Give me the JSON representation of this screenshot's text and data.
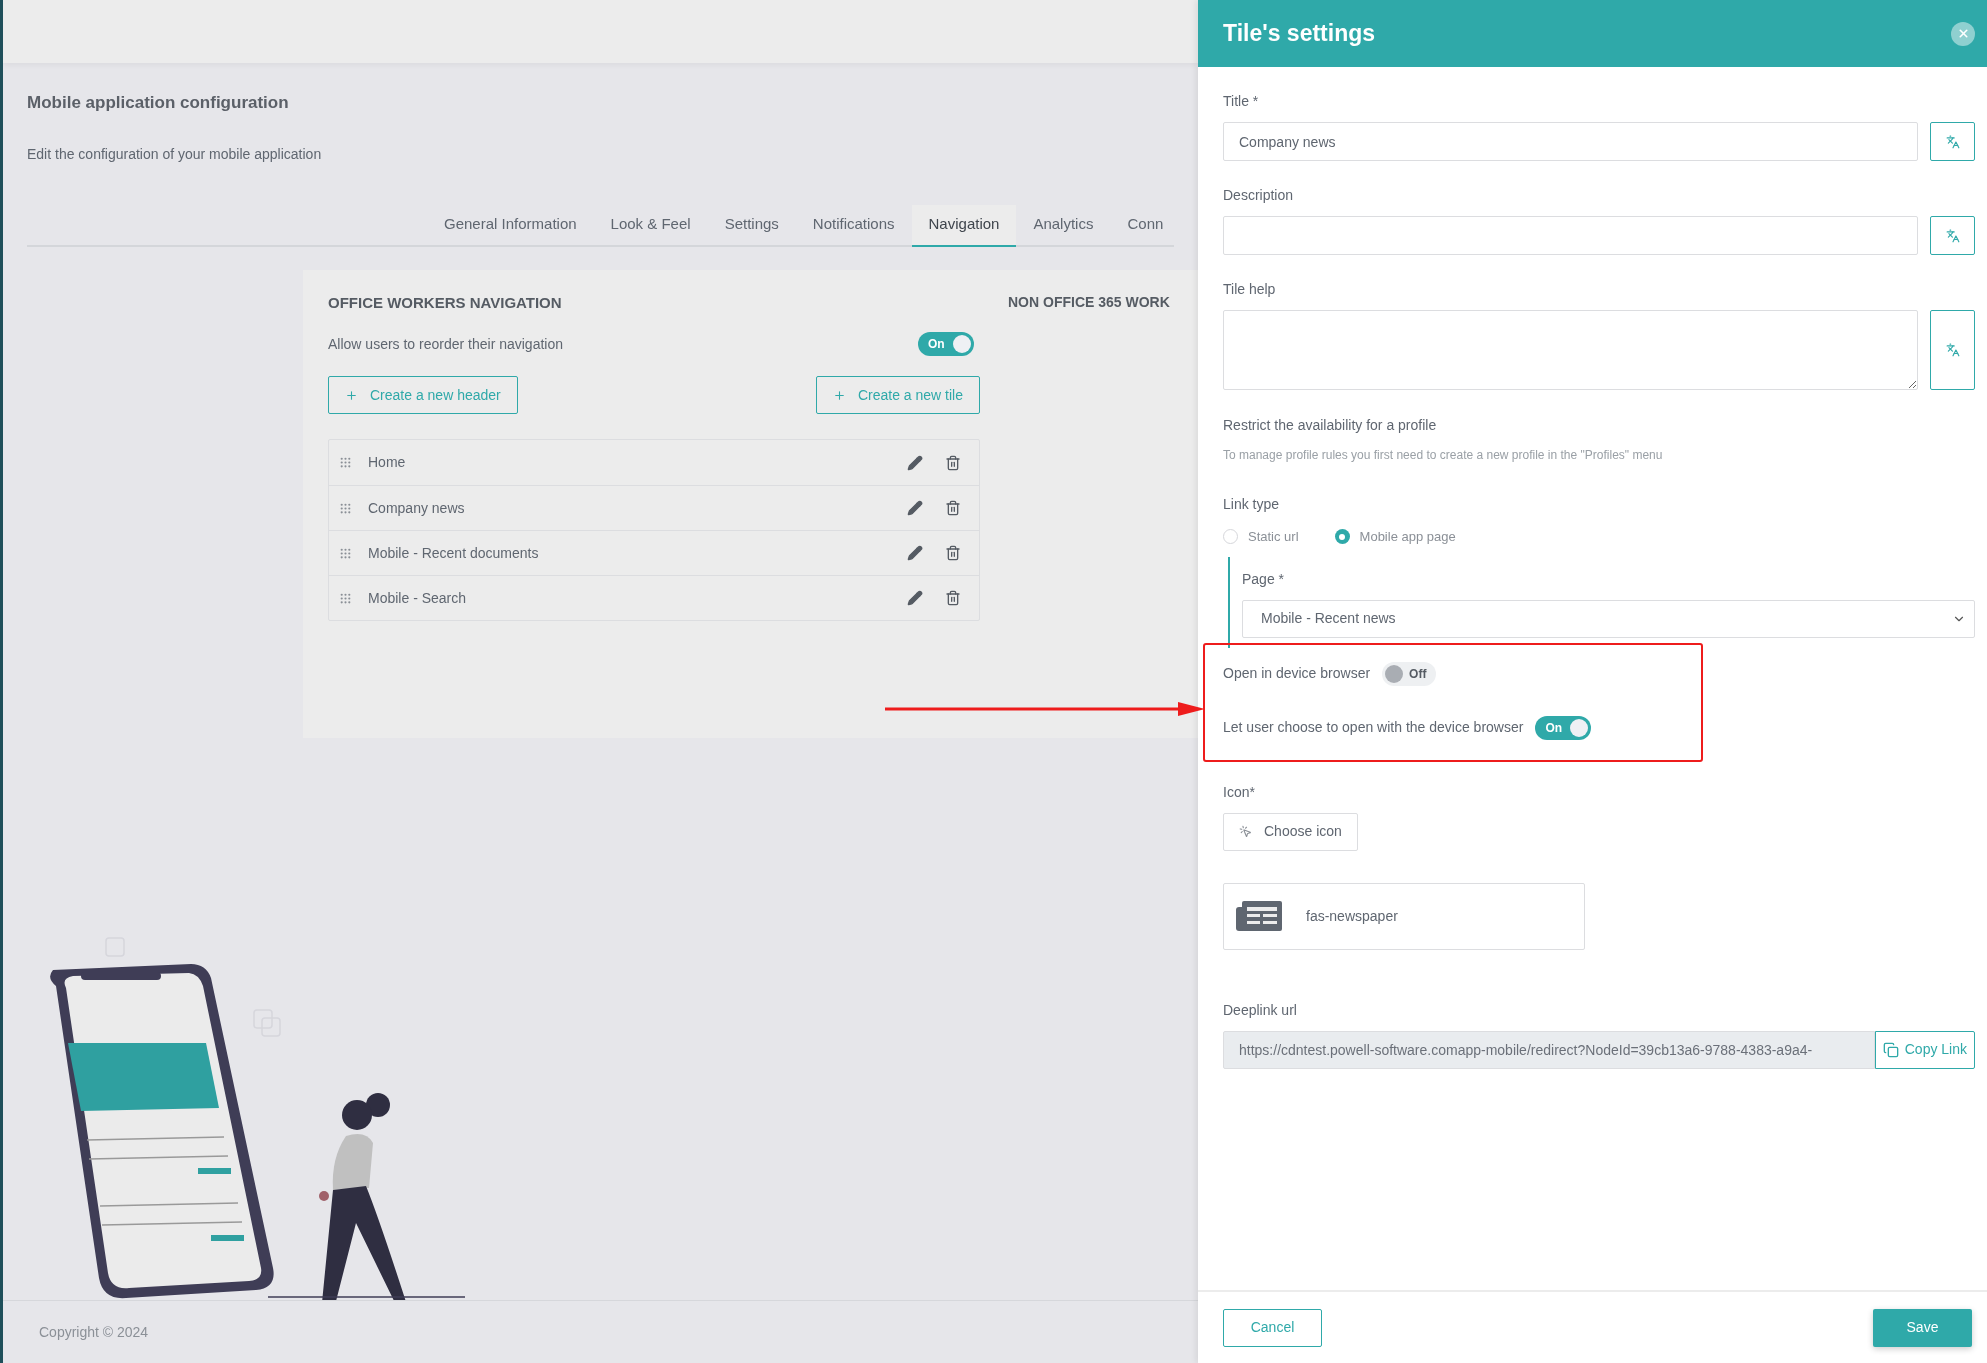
{
  "page": {
    "title": "Mobile application configuration",
    "subtitle": "Edit the configuration of your mobile application"
  },
  "tabs": [
    {
      "label": "General Information",
      "selected": false
    },
    {
      "label": "Look & Feel",
      "selected": false
    },
    {
      "label": "Settings",
      "selected": false
    },
    {
      "label": "Notifications",
      "selected": false
    },
    {
      "label": "Navigation",
      "selected": true
    },
    {
      "label": "Analytics",
      "selected": false
    },
    {
      "label": "Conn",
      "selected": false
    }
  ],
  "navigation_card": {
    "heading": "OFFICE WORKERS NAVIGATION",
    "reorder_label": "Allow users to reorder their navigation",
    "reorder_toggle": {
      "on": true,
      "label": "On"
    },
    "buttons": [
      {
        "label": "Create a new header"
      },
      {
        "label": "Create a new tile"
      }
    ],
    "items": [
      {
        "label": "Home"
      },
      {
        "label": "Company news"
      },
      {
        "label": "Mobile - Recent documents"
      },
      {
        "label": "Mobile - Search"
      }
    ],
    "second_heading": "NON OFFICE 365 WORK"
  },
  "footer": "Copyright © 2024",
  "panel": {
    "title": "Tile's settings",
    "title_field": {
      "label": "Title *",
      "value": "Company news"
    },
    "description_field": {
      "label": "Description"
    },
    "help_field": {
      "label": "Tile help"
    },
    "restrict": {
      "label": "Restrict the availability for a profile",
      "hint": "To manage profile rules you first need to create a new profile in the \"Profiles\" menu"
    },
    "link_type": {
      "label": "Link type",
      "options": [
        {
          "label": "Static url",
          "selected": false
        },
        {
          "label": "Mobile app page",
          "selected": true
        }
      ]
    },
    "page_field": {
      "label": "Page *",
      "value": "Mobile - Recent news"
    },
    "toggles": [
      {
        "label": "Open in device browser",
        "on": false,
        "state_label": "Off"
      },
      {
        "label": "Let user choose to open with the device browser",
        "on": true,
        "state_label": "On"
      }
    ],
    "icon": {
      "label": "Icon*",
      "button": "Choose icon",
      "name": "fas-newspaper"
    },
    "deeplink": {
      "label": "Deeplink url",
      "value": "https://cdntest.powell-software.comapp-mobile/redirect?NodeId=39cb13a6-9788-4383-a9a4-",
      "button": "Copy Link"
    },
    "cancel": "Cancel",
    "save": "Save"
  }
}
